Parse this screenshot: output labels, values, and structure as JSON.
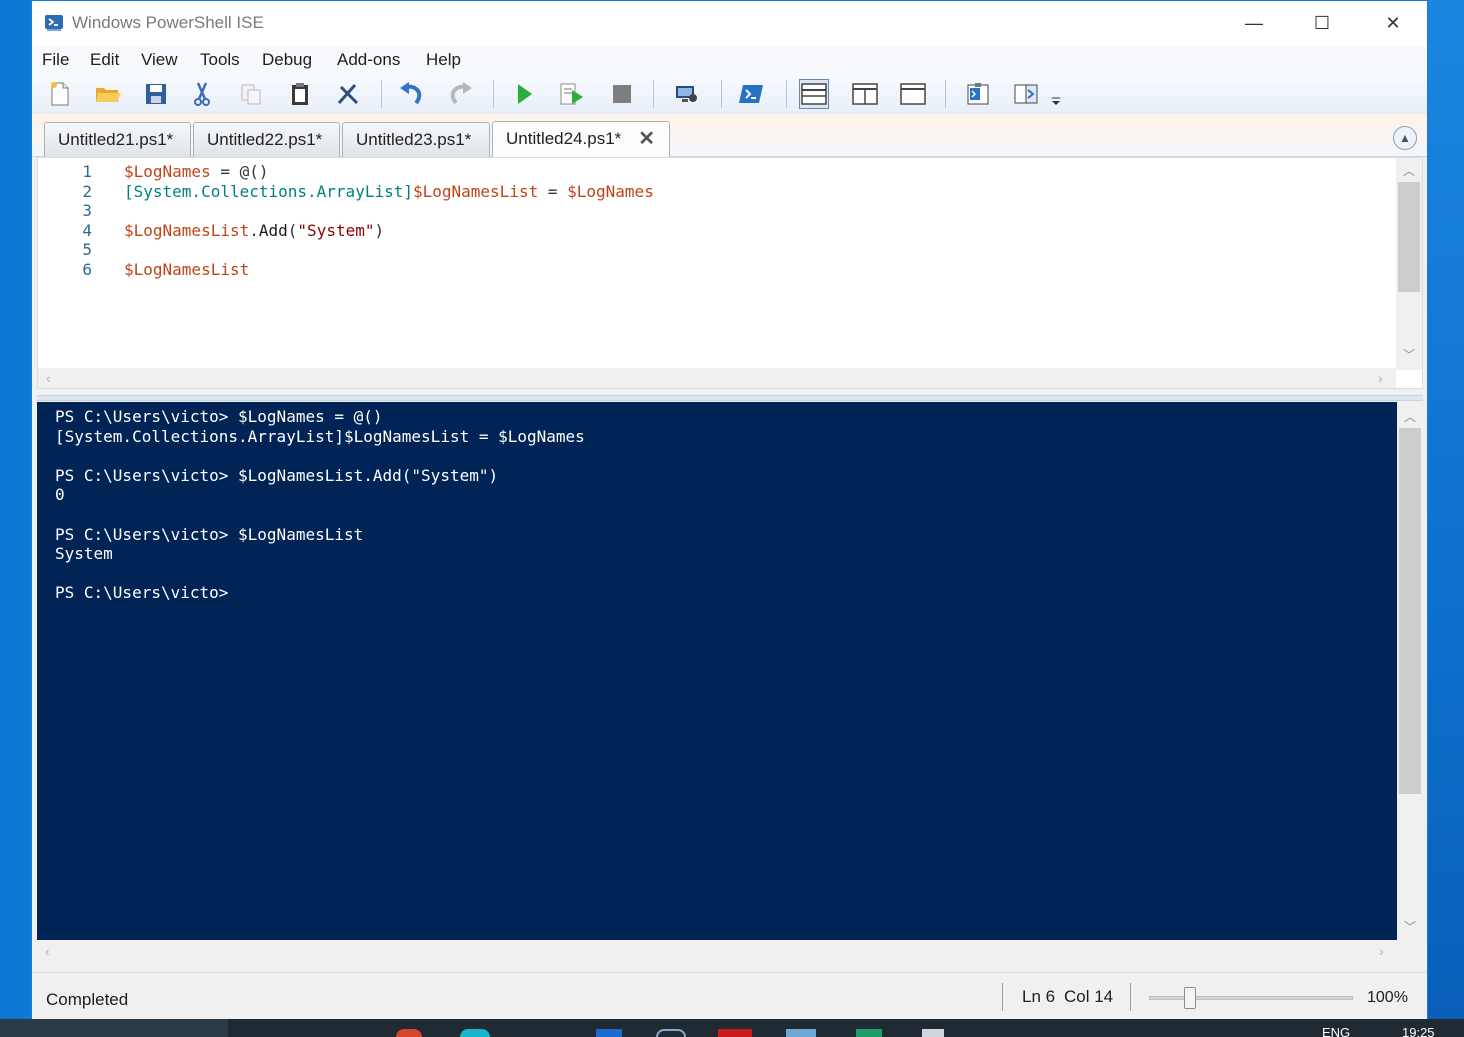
{
  "window": {
    "title": "Windows PowerShell ISE",
    "minimize": "—",
    "maximize": "☐",
    "close": "✕"
  },
  "menu": [
    "File",
    "Edit",
    "View",
    "Tools",
    "Debug",
    "Add-ons",
    "Help"
  ],
  "toolbar": {
    "buttons": [
      "new-script",
      "open",
      "save",
      "cut",
      "copy",
      "paste",
      "clear-console",
      "undo",
      "redo",
      "run-script",
      "run-selection",
      "stop",
      "new-remote-tab",
      "start-powershell",
      "show-script-top",
      "show-script-right",
      "show-script-maximized",
      "show-command",
      "show-command-addon"
    ]
  },
  "tabs": [
    {
      "label": "Untitled21.ps1*",
      "active": false
    },
    {
      "label": "Untitled22.ps1*",
      "active": false
    },
    {
      "label": "Untitled23.ps1*",
      "active": false
    },
    {
      "label": "Untitled24.ps1*",
      "active": true
    }
  ],
  "tab_close": "✕",
  "editor": {
    "line_numbers": [
      "1",
      "2",
      "3",
      "4",
      "5",
      "6"
    ],
    "lines": [
      [
        {
          "t": "$LogNames",
          "c": "var"
        },
        {
          "t": " = @()",
          "c": "op"
        }
      ],
      [
        {
          "t": "[System.Collections.ArrayList]",
          "c": "typ"
        },
        {
          "t": "$LogNamesList",
          "c": "var"
        },
        {
          "t": " = ",
          "c": "op"
        },
        {
          "t": "$LogNames",
          "c": "var"
        }
      ],
      [],
      [
        {
          "t": "$LogNamesList",
          "c": "var"
        },
        {
          "t": ".",
          "c": "op"
        },
        {
          "t": "Add",
          "c": "mem"
        },
        {
          "t": "(",
          "c": "op"
        },
        {
          "t": "\"System\"",
          "c": "str"
        },
        {
          "t": ")",
          "c": "op"
        }
      ],
      [],
      [
        {
          "t": "$LogNamesList",
          "c": "var"
        }
      ]
    ]
  },
  "console": {
    "lines": [
      "PS C:\\Users\\victo> $LogNames = @()",
      "[System.Collections.ArrayList]$LogNamesList = $LogNames",
      "",
      "PS C:\\Users\\victo> $LogNamesList.Add(\"System\")",
      "0",
      "",
      "PS C:\\Users\\victo> $LogNamesList",
      "System",
      "",
      "PS C:\\Users\\victo>"
    ]
  },
  "status": {
    "text": "Completed",
    "ln": "Ln 6",
    "col": "Col 14",
    "zoom": "100%",
    "zoom_level": 0.2
  },
  "taskbar": {
    "lang": "ENG",
    "time": "19:25"
  },
  "colors": {
    "console_bg": "#012456",
    "variable": "#c0441a",
    "type": "#008080"
  }
}
